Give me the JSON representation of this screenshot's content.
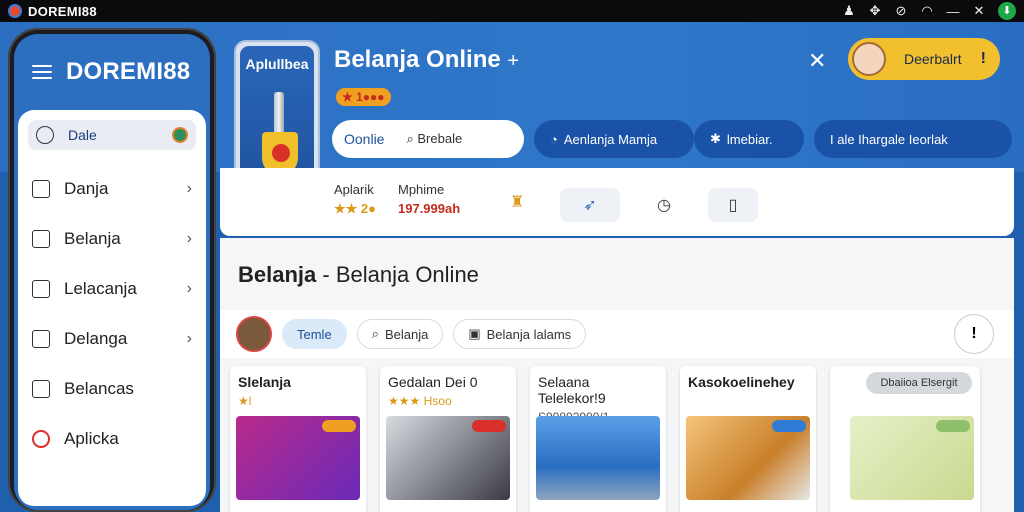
{
  "os": {
    "title": "DOREMI88"
  },
  "phone": {
    "brand": "DOREMI88",
    "items": [
      {
        "label": "Dale"
      },
      {
        "label": "Danja"
      },
      {
        "label": "Belanja"
      },
      {
        "label": "Lelacanja"
      },
      {
        "label": "Delanga"
      },
      {
        "label": "Belancas"
      },
      {
        "label": "Aplicka"
      }
    ]
  },
  "app": {
    "tile_label": "Aplullbea",
    "title": "Belanja Online",
    "title_plus": "+",
    "rating": "★ 1●●●",
    "profile_label": "Deerbalrt",
    "tabs": {
      "seg_on": "Oonlie",
      "seg_off": "Brebale",
      "btn1": "Aenlanja Mamja",
      "btn2": "lmebiar.",
      "btn3": "I ale Ihargale Ieorlak"
    }
  },
  "stats": {
    "lbl1": "Aplarik",
    "val1": "★★ 2●",
    "lbl2": "Mphime",
    "val2": "197.999ah"
  },
  "content": {
    "heading_bold": "Belanja",
    "heading_rest": " - Belanja Online",
    "chips": [
      "Temle",
      "Belanja",
      "Belanja lalams"
    ],
    "info": "!",
    "cards": [
      {
        "title": "Slelanja",
        "sub": "★l"
      },
      {
        "title": "Gedalan Dei   0",
        "sub": "★★★ Hsoo"
      },
      {
        "title": "Selaana Telelekor!9",
        "sub": "S99802900/1"
      },
      {
        "title": "Kasokoelinehey",
        "sub": ""
      },
      {
        "title": "",
        "sub": "",
        "pill": "Dbaiioa Elsergit"
      }
    ]
  },
  "colors": {
    "primary": "#2c6fc1",
    "accent": "#f2c02e",
    "alert": "#d9302a"
  }
}
